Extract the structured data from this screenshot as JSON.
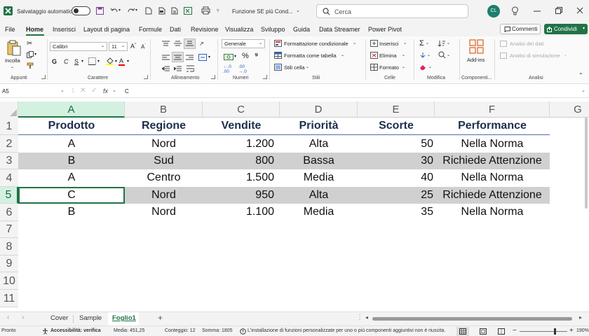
{
  "titlebar": {
    "autosave_label": "Salvataggio automatico",
    "filename": "Funzione SE più Cond...",
    "search_placeholder": "Cerca",
    "avatar": "CL"
  },
  "menu": {
    "items": [
      "File",
      "Home",
      "Inserisci",
      "Layout di pagina",
      "Formule",
      "Dati",
      "Revisione",
      "Visualizza",
      "Sviluppo",
      "Guida",
      "Data Streamer",
      "Power Pivot"
    ],
    "active": "Home",
    "comments": "Commenti",
    "share": "Condividi"
  },
  "ribbon": {
    "paste": "Incolla",
    "groups": [
      "Appunti",
      "Carattere",
      "Allineamento",
      "Numeri",
      "Stili",
      "Celle",
      "Modifica",
      "Componenti...",
      "Analisi"
    ],
    "font_name": "Calibri",
    "font_size": "11",
    "bold": "G",
    "italic": "C",
    "underline": "S",
    "number_format": "Generale",
    "styles": [
      "Formattazione condizionale",
      "Formatta come tabella",
      "Stili cella"
    ],
    "cells": [
      "Inserisci",
      "Elimina",
      "Formato"
    ],
    "addins": "Add-ins",
    "analysis": [
      "Analisi dei dati",
      "Analisi di simulazione"
    ]
  },
  "formula": {
    "name_box": "A5",
    "fx": "fx",
    "content": "C"
  },
  "columns": [
    "A",
    "B",
    "C",
    "D",
    "E",
    "F",
    "G"
  ],
  "rows": [
    "1",
    "2",
    "3",
    "4",
    "5",
    "6",
    "7",
    "8",
    "9",
    "10",
    "11"
  ],
  "table": {
    "headers": [
      "Prodotto",
      "Regione",
      "Vendite",
      "Priorità",
      "Scorte",
      "Performance"
    ],
    "rows": [
      [
        "A",
        "Nord",
        "1.200",
        "Alta",
        "50",
        "Nella Norma"
      ],
      [
        "B",
        "Sud",
        "800",
        "Bassa",
        "30",
        "Richiede Attenzione"
      ],
      [
        "A",
        "Centro",
        "1.500",
        "Media",
        "40",
        "Nella Norma"
      ],
      [
        "C",
        "Nord",
        "950",
        "Alta",
        "25",
        "Richiede Attenzione"
      ],
      [
        "B",
        "Nord",
        "1.100",
        "Media",
        "35",
        "Nella Norma"
      ]
    ]
  },
  "sheets": {
    "tabs": [
      "Cover",
      "Sample",
      "Foglio1"
    ],
    "active": "Foglio1"
  },
  "status": {
    "ready": "Pronto",
    "accessibility": "Accessibilità: verifica",
    "average": "Media: 451,25",
    "count": "Conteggio: 12",
    "sum": "Somma: 1805",
    "message": "L'installazione di funzioni personalizzate per uno o più componenti aggiuntivi non è riuscita.",
    "zoom": "190%"
  },
  "colors": {
    "accent": "#217346",
    "band": "#d0d0d0",
    "header_text": "#1f2d4d"
  }
}
